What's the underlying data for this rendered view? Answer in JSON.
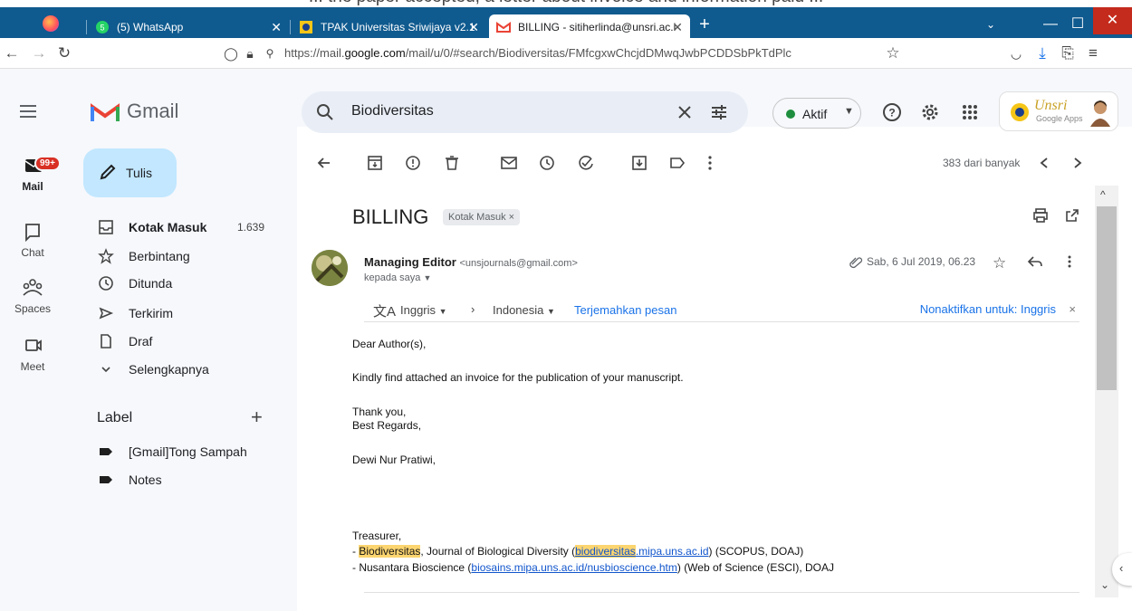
{
  "caption": "... the paper accepted, a letter about invoice and information paid ...",
  "browser": {
    "tabs": [
      {
        "label": "(5) WhatsApp"
      },
      {
        "label": "TPAK Universitas Sriwijaya v2.1"
      },
      {
        "label": "BILLING - sitiherlinda@unsri.ac.i"
      }
    ],
    "url_prefix": "https://mail.",
    "url_domain": "google.com",
    "url_path": "/mail/u/0/#search/Biodiversitas/FMfcgxwChcjdDMwqJwbPCDDSbPkTdPlc"
  },
  "header": {
    "app_name": "Gmail",
    "search_query": "Biodiversitas",
    "status_label": "Aktif",
    "status_color": "#1e8e3e",
    "org_logo_text": "Unsri",
    "org_logo_sub": "Google Apps"
  },
  "rail": {
    "mail_badge": "99+",
    "items": [
      {
        "label": "Mail",
        "icon": "mail-icon"
      },
      {
        "label": "Chat",
        "icon": "chat-icon"
      },
      {
        "label": "Spaces",
        "icon": "spaces-icon"
      },
      {
        "label": "Meet",
        "icon": "meet-icon"
      }
    ]
  },
  "sidebar": {
    "compose_label": "Tulis",
    "items": [
      {
        "label": "Kotak Masuk",
        "count": "1.639",
        "icon": "inbox-icon"
      },
      {
        "label": "Berbintang",
        "icon": "star-icon"
      },
      {
        "label": "Ditunda",
        "icon": "clock-icon"
      },
      {
        "label": "Terkirim",
        "icon": "send-icon"
      },
      {
        "label": "Draf",
        "icon": "draft-icon"
      },
      {
        "label": "Selengkapnya",
        "icon": "chevron-down-icon"
      }
    ],
    "labels_heading": "Label",
    "labels": [
      {
        "label": "[Gmail]Tong Sampah"
      },
      {
        "label": "Notes"
      }
    ]
  },
  "message": {
    "pager": "383 dari banyak",
    "subject": "BILLING",
    "label_chip": "Kotak Masuk",
    "sender_name": "Managing Editor",
    "sender_email": "<unsjournals@gmail.com>",
    "recipient": "kepada saya",
    "date": "Sab, 6 Jul 2019, 06.23",
    "translate_from": "Inggris",
    "translate_to": "Indonesia",
    "translate_link": "Terjemahkan pesan",
    "translate_off": "Nonaktifkan untuk: Inggris",
    "body": {
      "greeting": "Dear Author(s),",
      "line1": "Kindly find attached an invoice for the publication of your manuscript.",
      "thanks": "Thank you,",
      "regards": "Best Regards,",
      "signer": "Dewi Nur Pratiwi,",
      "role": "Treasurer,",
      "j1_prefix": "- ",
      "j1_name": "Biodiversitas",
      "j1_text": ", Journal of Biological Diversity (",
      "j1_link_hl": "biodiversitas",
      "j1_link_rest": ".mipa.uns.ac.id",
      "j1_suffix": ") (SCOPUS, DOAJ)",
      "j2_prefix": "- Nusantara Bioscience (",
      "j2_link": "biosains.mipa.uns.ac.id/nusbioscience.htm",
      "j2_suffix": ") (Web of Science (ESCI), DOAJ"
    }
  }
}
